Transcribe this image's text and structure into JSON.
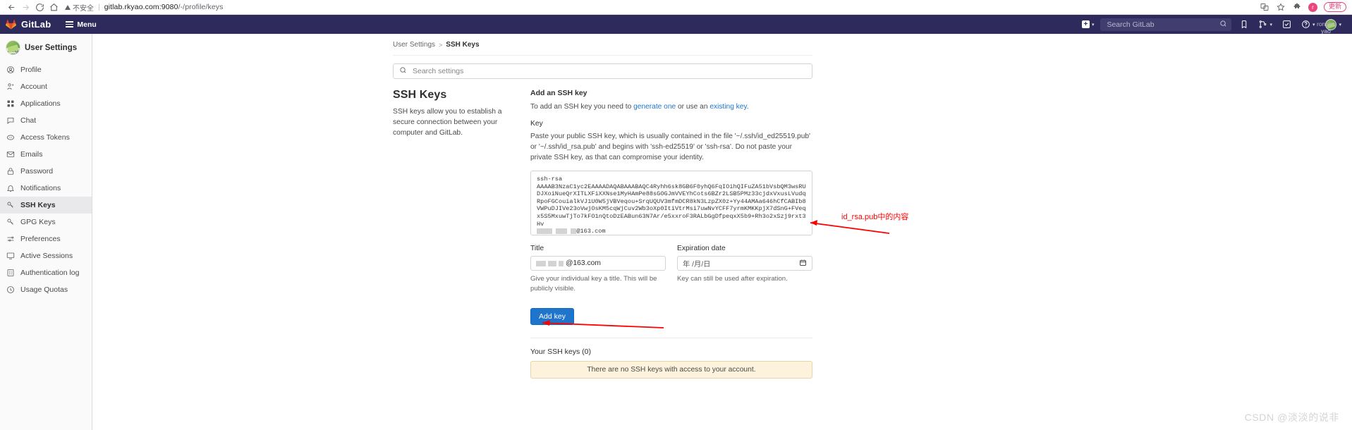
{
  "browser": {
    "back_icon": "back-arrow-icon",
    "forward_icon": "forward-arrow-icon",
    "reload_icon": "reload-icon",
    "home_icon": "home-icon",
    "security_label": "不安全",
    "url_host": "gitlab.rkyao.com:9080",
    "url_path": "/-/profile/keys",
    "translate_icon": "translate-icon",
    "bookmark_icon": "star-icon",
    "extensions_icon": "puzzle-icon",
    "profile_initial": "r",
    "update_label": "更新"
  },
  "navbar": {
    "brand": "GitLab",
    "menu_label": "Menu",
    "new_icon": "plus-square-icon",
    "search_placeholder": "Search GitLab",
    "search_icon": "search-icon",
    "issues_icon": "issues-icon",
    "merge_requests_icon": "merge-request-icon",
    "todos_icon": "todos-checkbox-icon",
    "help_icon": "help-circle-icon",
    "avatar_icon": "user-avatar",
    "user_name_line1": "rongke",
    "user_name_line2": "yao"
  },
  "sidebar": {
    "avatar_label": "rong",
    "title": "User Settings",
    "items": [
      {
        "label": "Profile",
        "icon": "user-circle-icon",
        "active": false
      },
      {
        "label": "Account",
        "icon": "account-key-icon",
        "active": false
      },
      {
        "label": "Applications",
        "icon": "applications-grid-icon",
        "active": false
      },
      {
        "label": "Chat",
        "icon": "chat-bubble-icon",
        "active": false
      },
      {
        "label": "Access Tokens",
        "icon": "token-icon",
        "active": false
      },
      {
        "label": "Emails",
        "icon": "envelope-icon",
        "active": false
      },
      {
        "label": "Password",
        "icon": "lock-icon",
        "active": false
      },
      {
        "label": "Notifications",
        "icon": "bell-icon",
        "active": false
      },
      {
        "label": "SSH Keys",
        "icon": "key-icon",
        "active": true
      },
      {
        "label": "GPG Keys",
        "icon": "key-icon",
        "active": false
      },
      {
        "label": "Preferences",
        "icon": "sliders-icon",
        "active": false
      },
      {
        "label": "Active Sessions",
        "icon": "monitor-icon",
        "active": false
      },
      {
        "label": "Authentication log",
        "icon": "list-log-icon",
        "active": false
      },
      {
        "label": "Usage Quotas",
        "icon": "clock-icon",
        "active": false
      }
    ]
  },
  "breadcrumb": {
    "parent": "User Settings",
    "separator": ">",
    "current": "SSH Keys"
  },
  "search_settings": {
    "placeholder": "Search settings",
    "value": "",
    "icon": "search-icon"
  },
  "ssh_section": {
    "heading": "SSH Keys",
    "description": "SSH keys allow you to establish a secure connection between your computer and GitLab."
  },
  "add_key": {
    "title": "Add an SSH key",
    "intro_prefix": "To add an SSH key you need to ",
    "link_generate": "generate one",
    "intro_middle": " or use an ",
    "link_existing": "existing key",
    "intro_suffix": ".",
    "key_label": "Key",
    "key_help": "Paste your public SSH key, which is usually contained in the file '~/.ssh/id_ed25519.pub' or '~/.ssh/id_rsa.pub' and begins with 'ssh-ed25519' or 'ssh-rsa'. Do not paste your private SSH key, as that can compromise your identity.",
    "key_value": "ssh-rsa\nAAAAB3NzaC1yc2EAAAADAQABAAABAQC4Ryhh6sk8GB6F0yhQ6FqIOihQIFuZA51bVsbQM3wsRUDJXoiNueQrXITLXFiXXNse1MyHAmPe88sGOGJmVVEYhCots6BZr2LSB5PMz33cjdxVxusLVudqRpoFGCouialkVJ1U0W5jVBVeqou+SrqUQUV3mfmDCR8kN3LzpZX0z+Yy44AMAa646hCfCABIb8VWPuDJIVe23oVwjOsKM5cqWjCuv2Wb3oXp0ItiVtrMsi7uwNvYCFF7yrmKMKKpjX7dSnG+FVeqx5S5MxuwTjTo7kFO1nQtoDzEABun63N7Ar/e5xxroF3RALbGgDfpeqxX5b9+Rh3o2xSzj9rxt3Hv",
    "key_value_suffix": "@163.com",
    "title_label": "Title",
    "title_value_suffix": "@163.com",
    "title_help": "Give your individual key a title. This will be publicly visible.",
    "expiration_label": "Expiration date",
    "expiration_placeholder": "年 /月/日",
    "expiration_icon": "calendar-icon",
    "expiration_help": "Key can still be used after expiration.",
    "submit_label": "Add key"
  },
  "your_keys": {
    "heading": "Your SSH keys (0)",
    "empty_message": "There are no SSH keys with access to your account."
  },
  "annotations": {
    "key_note": "id_rsa.pub中的内容",
    "arrow_color": "#ff0000"
  },
  "watermark": "CSDN @淡淡的说非"
}
